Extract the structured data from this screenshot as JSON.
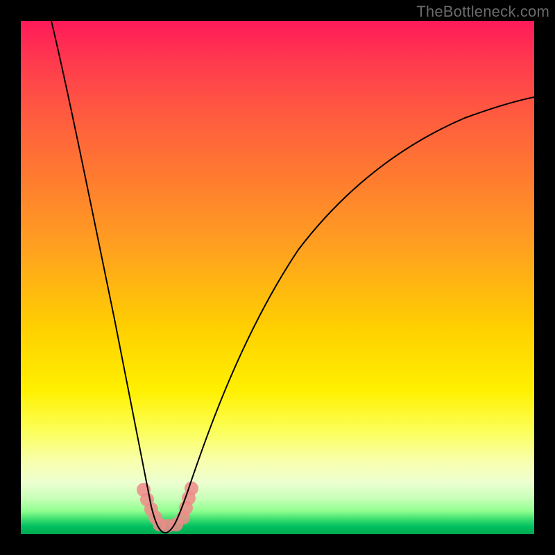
{
  "watermark": "TheBottleneck.com",
  "colors": {
    "frame": "#000000",
    "curve": "#000000",
    "marker": "#f08a8a",
    "gradient_stops": [
      "#ff1a59",
      "#ff3a4e",
      "#ff5a40",
      "#ff7a30",
      "#ffa020",
      "#ffd000",
      "#fff000",
      "#fbff5a",
      "#f8ffb0",
      "#ecffd0",
      "#c8ffb8",
      "#90ff90",
      "#40e070",
      "#00c060",
      "#00a850"
    ]
  },
  "chart_data": {
    "type": "line",
    "title": "",
    "xlabel": "",
    "ylabel": "",
    "xlim": [
      0,
      100
    ],
    "ylim": [
      0,
      100
    ],
    "notes": "V-shaped bottleneck curve. Two branches descend from top edge and meet near the bottom at a minimum around x≈27. Values read as approximate percent of plot height (0 = bottom, 100 = top). No axis ticks or labels are rendered.",
    "series": [
      {
        "name": "left-branch",
        "x": [
          6,
          10,
          14,
          18,
          21,
          23.5,
          25,
          26,
          27
        ],
        "values": [
          100,
          84,
          66,
          46,
          28,
          14,
          6,
          2,
          0
        ]
      },
      {
        "name": "right-branch",
        "x": [
          27,
          29,
          31,
          34,
          38,
          44,
          52,
          62,
          74,
          86,
          100
        ],
        "values": [
          0,
          4,
          12,
          24,
          38,
          52,
          64,
          73,
          79,
          83,
          85
        ]
      }
    ],
    "markers": {
      "name": "highlighted-region",
      "approx_x_range": [
        24,
        32
      ],
      "approx_y_range": [
        0,
        8
      ],
      "description": "Cluster of soft pink rounded markers near the minimum of the curve"
    }
  }
}
